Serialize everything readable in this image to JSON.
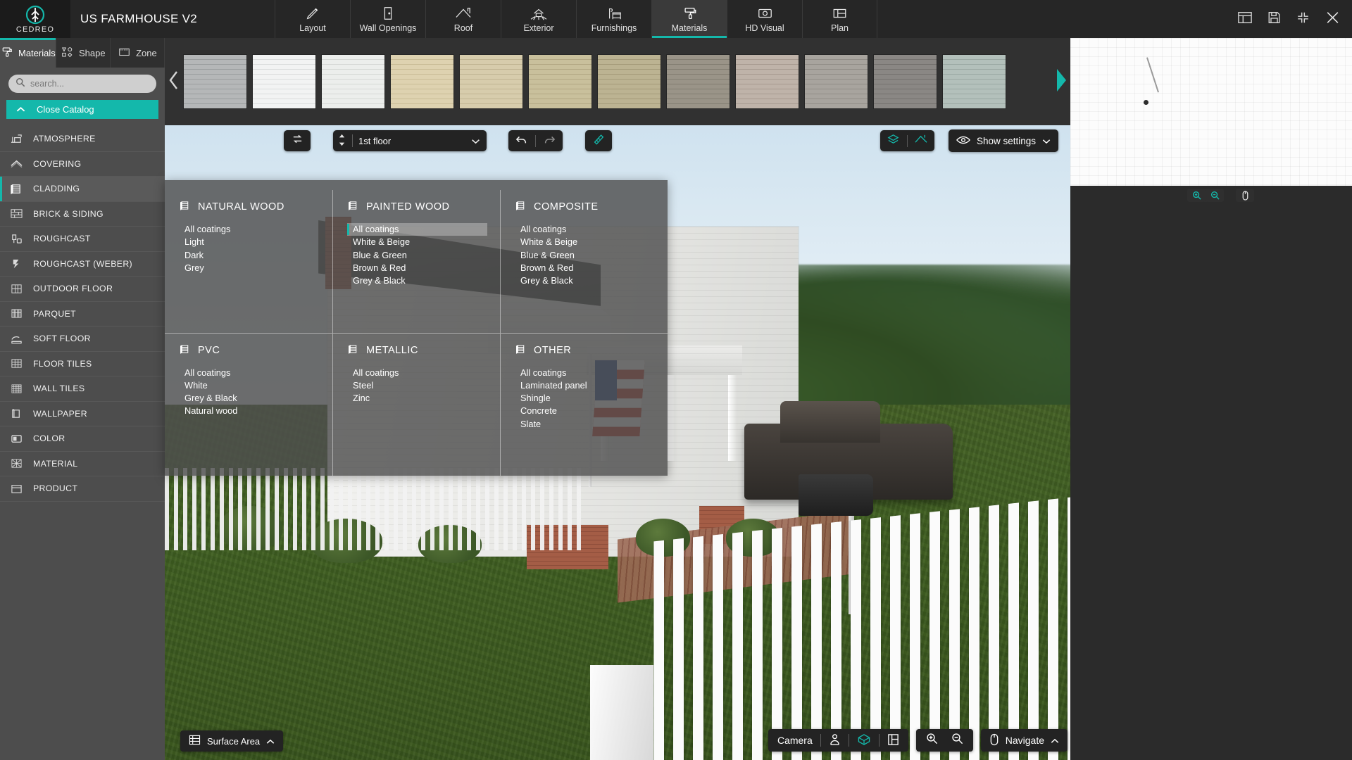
{
  "app": {
    "brand": "CEDREO",
    "project_title": "US FARMHOUSE V2"
  },
  "topbar": {
    "tabs": [
      {
        "label": "Layout",
        "icon": "pencil-icon",
        "active": false
      },
      {
        "label": "Wall Openings",
        "icon": "door-icon",
        "active": false
      },
      {
        "label": "Roof",
        "icon": "roof-icon",
        "active": false
      },
      {
        "label": "Exterior",
        "icon": "exterior-icon",
        "active": false
      },
      {
        "label": "Furnishings",
        "icon": "furnishings-icon",
        "active": false
      },
      {
        "label": "Materials",
        "icon": "paint-roller-icon",
        "active": true
      },
      {
        "label": "HD Visual",
        "icon": "camera-icon",
        "active": false
      },
      {
        "label": "Plan",
        "icon": "plan-icon",
        "active": false
      }
    ],
    "right_icons": [
      "list-view-icon",
      "save-icon",
      "collapse-icon",
      "close-icon"
    ]
  },
  "left_panel": {
    "tabs": [
      {
        "label": "Materials",
        "icon": "paint-roller-icon",
        "active": true
      },
      {
        "label": "Shape",
        "icon": "shapes-icon",
        "active": false
      },
      {
        "label": "Zone",
        "icon": "zone-icon",
        "active": false
      }
    ],
    "search": {
      "placeholder": "search...",
      "value": "",
      "icon": "search-icon"
    },
    "close_catalog": {
      "label": "Close Catalog",
      "icon": "chevron-up-icon",
      "accent": "#14b8ab"
    },
    "categories": [
      {
        "label": "ATMOSPHERE",
        "icon": "atmosphere-icon",
        "active": false
      },
      {
        "label": "COVERING",
        "icon": "covering-icon",
        "active": false
      },
      {
        "label": "CLADDING",
        "icon": "cladding-icon",
        "active": true
      },
      {
        "label": "BRICK & SIDING",
        "icon": "brick-icon",
        "active": false
      },
      {
        "label": "ROUGHCAST",
        "icon": "roughcast-icon",
        "active": false
      },
      {
        "label": "ROUGHCAST (WEBER)",
        "icon": "roughcast-weber-icon",
        "active": false
      },
      {
        "label": "OUTDOOR FLOOR",
        "icon": "outdoor-floor-icon",
        "active": false
      },
      {
        "label": "PARQUET",
        "icon": "parquet-icon",
        "active": false
      },
      {
        "label": "SOFT FLOOR",
        "icon": "soft-floor-icon",
        "active": false
      },
      {
        "label": "FLOOR TILES",
        "icon": "floor-tiles-icon",
        "active": false
      },
      {
        "label": "WALL TILES",
        "icon": "wall-tiles-icon",
        "active": false
      },
      {
        "label": "WALLPAPER",
        "icon": "wallpaper-icon",
        "active": false
      },
      {
        "label": "COLOR",
        "icon": "color-icon",
        "active": false
      },
      {
        "label": "MATERIAL",
        "icon": "material-icon",
        "active": false
      },
      {
        "label": "PRODUCT",
        "icon": "product-icon",
        "active": false
      }
    ]
  },
  "catalog_strip": {
    "prev_icon": "chevron-left-icon",
    "next_icon": "chevron-right-icon",
    "swatches": [
      {
        "name": "grey-narrow-siding",
        "color": "#b5b7b8",
        "stripe": "#9a9d9e"
      },
      {
        "name": "white-siding",
        "color": "#f2f3f3",
        "stripe": "#dadcdc"
      },
      {
        "name": "off-white-siding",
        "color": "#eceeec",
        "stripe": "#d5d8d5"
      },
      {
        "name": "cream-siding",
        "color": "#ded2b0",
        "stripe": "#c9bc96"
      },
      {
        "name": "beige-siding",
        "color": "#d7ccac",
        "stripe": "#c0b492"
      },
      {
        "name": "khaki-siding",
        "color": "#c9c09c",
        "stripe": "#b2a783"
      },
      {
        "name": "olive-beige-siding",
        "color": "#bcb392",
        "stripe": "#a49a79"
      },
      {
        "name": "taupe-siding",
        "color": "#9a9488",
        "stripe": "#827d71"
      },
      {
        "name": "warm-grey-siding",
        "color": "#bfb3a9",
        "stripe": "#a79a90"
      },
      {
        "name": "stone-grey-siding",
        "color": "#a8a49e",
        "stripe": "#918d87"
      },
      {
        "name": "dark-grey-siding",
        "color": "#8a8784",
        "stripe": "#74716e"
      },
      {
        "name": "sage-green-siding",
        "color": "#b3c0bb",
        "stripe": "#9aa8a3"
      }
    ]
  },
  "viewport_toolbar": {
    "swap_icon": "swap-icon",
    "floor_stepper_icon": "stepper-icon",
    "floor_value": "1st floor",
    "floor_chevron": "chevron-down-icon",
    "undo_icon": "undo-icon",
    "redo_icon": "redo-icon",
    "measure_icon": "measure-icon",
    "layers_icon": "layers-icon",
    "roof_toggle_icon": "roof-toggle-icon",
    "show_settings": {
      "label": "Show settings",
      "icon": "eye-icon",
      "chevron": "chevron-down-icon"
    }
  },
  "megamenu": {
    "columns": [
      {
        "title": "NATURAL WOOD",
        "icon": "cladding-icon",
        "items": [
          {
            "label": "All coatings",
            "selected": false
          },
          {
            "label": "Light",
            "selected": false
          },
          {
            "label": "Dark",
            "selected": false
          },
          {
            "label": "Grey",
            "selected": false
          }
        ]
      },
      {
        "title": "PAINTED WOOD",
        "icon": "cladding-icon",
        "items": [
          {
            "label": "All coatings",
            "selected": true
          },
          {
            "label": "White & Beige",
            "selected": false
          },
          {
            "label": "Blue & Green",
            "selected": false
          },
          {
            "label": "Brown & Red",
            "selected": false
          },
          {
            "label": "Grey & Black",
            "selected": false
          }
        ]
      },
      {
        "title": "COMPOSITE",
        "icon": "cladding-icon",
        "items": [
          {
            "label": "All coatings",
            "selected": false
          },
          {
            "label": "White & Beige",
            "selected": false
          },
          {
            "label": "Blue & Green",
            "selected": false
          },
          {
            "label": "Brown & Red",
            "selected": false
          },
          {
            "label": "Grey & Black",
            "selected": false
          }
        ]
      },
      {
        "title": "PVC",
        "icon": "cladding-icon",
        "items": [
          {
            "label": "All coatings",
            "selected": false
          },
          {
            "label": "White",
            "selected": false
          },
          {
            "label": "Grey & Black",
            "selected": false
          },
          {
            "label": "Natural wood",
            "selected": false
          }
        ]
      },
      {
        "title": "METALLIC",
        "icon": "cladding-icon",
        "items": [
          {
            "label": "All coatings",
            "selected": false
          },
          {
            "label": "Steel",
            "selected": false
          },
          {
            "label": "Zinc",
            "selected": false
          }
        ]
      },
      {
        "title": "OTHER",
        "icon": "other-cladding-icon",
        "items": [
          {
            "label": "All coatings",
            "selected": false
          },
          {
            "label": "Laminated panel",
            "selected": false
          },
          {
            "label": "Shingle",
            "selected": false
          },
          {
            "label": "Concrete",
            "selected": false
          },
          {
            "label": "Slate",
            "selected": false
          }
        ]
      }
    ]
  },
  "right_panel": {
    "plan_tools": [
      {
        "name": "zoom-in-icon"
      },
      {
        "name": "zoom-out-icon"
      },
      {
        "name": "pan-icon"
      }
    ]
  },
  "bottom_bar": {
    "surface_area": {
      "label": "Surface Area",
      "icon": "table-icon",
      "chevron": "chevron-up-icon"
    },
    "camera": {
      "label": "Camera",
      "icons": [
        {
          "name": "person-view-icon",
          "active": false
        },
        {
          "name": "cube-view-icon",
          "active": true
        },
        {
          "name": "plan-view-icon",
          "active": false
        }
      ]
    },
    "zoom": [
      {
        "name": "zoom-in-icon"
      },
      {
        "name": "zoom-out-icon"
      }
    ],
    "navigate": {
      "label": "Navigate",
      "icon": "mouse-icon",
      "chevron": "chevron-up-icon"
    }
  },
  "colors": {
    "accent": "#14b8ab",
    "topbar_bg": "#262626",
    "panel_bg": "#4d4d4d",
    "strip_bg": "#313131",
    "menu_bg": "rgba(78,78,78,.82)"
  }
}
